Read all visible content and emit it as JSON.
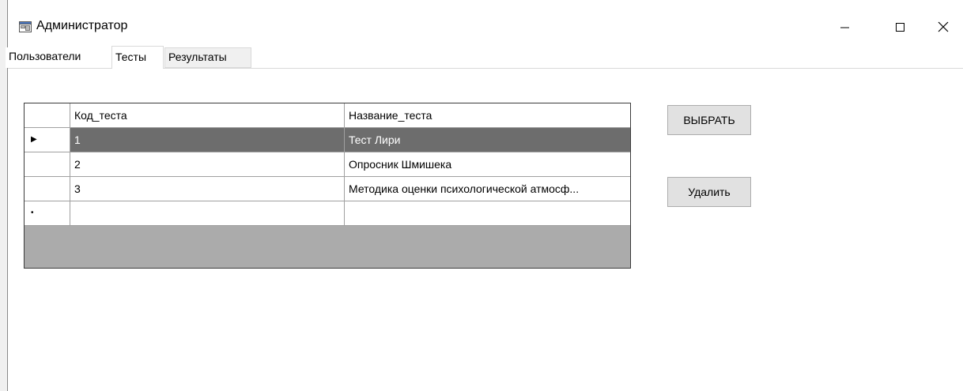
{
  "window": {
    "title": "Администратор",
    "controls": {
      "minimize": "–",
      "maximize": "☐",
      "close": "✕"
    }
  },
  "tabs": [
    {
      "label": "Пользователи",
      "selected": false
    },
    {
      "label": "Тесты",
      "selected": true
    },
    {
      "label": "Результаты",
      "selected": false
    }
  ],
  "grid": {
    "columns": [
      "Код_теста",
      "Название_теста"
    ],
    "rows": [
      {
        "marker": "▶",
        "code": "1",
        "name": "Тест Лири",
        "selected": true
      },
      {
        "marker": "",
        "code": "2",
        "name": "Опросник Шмишека",
        "selected": false
      },
      {
        "marker": "",
        "code": "3",
        "name": "Методика оценки психологической атмосф...",
        "selected": false
      },
      {
        "marker": "•",
        "code": "",
        "name": "",
        "selected": false
      }
    ]
  },
  "buttons": {
    "select": "ВЫБРАТЬ",
    "delete": "Удалить"
  },
  "colors": {
    "selection": "#6d6d6d",
    "grid_empty": "#ababab",
    "button": "#e1e1e1"
  },
  "icons": {
    "app": "form-window-icon"
  }
}
